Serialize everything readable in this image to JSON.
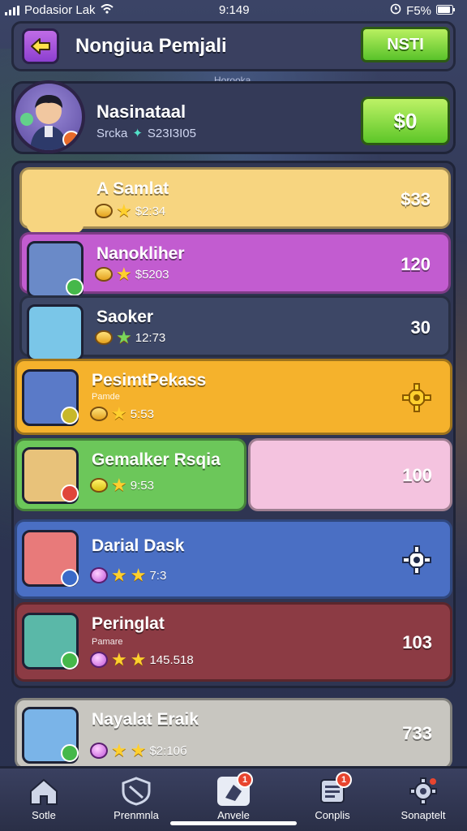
{
  "status_bar": {
    "carrier": "Podasior Lak",
    "time": "9:149",
    "battery": "F5%"
  },
  "header": {
    "title": "Nongiua Pemjali",
    "next_label": "NSTI",
    "subtitle": "Horooka"
  },
  "profile": {
    "name": "Nasinataal",
    "sub_label": "Srcka",
    "sub_value": "S23I3I05",
    "cash_label": "$0"
  },
  "rows": [
    {
      "name": "A Samlat",
      "tag": "",
      "stats": "$2:34",
      "value": "$33",
      "color": "#f7d580",
      "stars": 1,
      "currency": "coin"
    },
    {
      "name": "Nanokliher",
      "tag": "",
      "stats": "$5203",
      "value": "120",
      "color": "#c25cd0",
      "stars": 1,
      "currency": "coin"
    },
    {
      "name": "Saoker",
      "tag": "",
      "stats": "12:73",
      "value": "30",
      "color": "#3d4766",
      "stars": 1,
      "currency": "coin"
    },
    {
      "name": "PesimtPekass",
      "tag": "Pamde",
      "stats": "5:53",
      "value": "",
      "color": "#f5b22c",
      "stars": 1,
      "currency": "coin"
    },
    {
      "name": "Gemalker Rsqia",
      "tag": "",
      "stats": "9:53",
      "value": "100",
      "color": "#6cc75a",
      "stars": 1,
      "currency": "coin"
    },
    {
      "name": "Darial Dask",
      "tag": "",
      "stats": "7:3",
      "value": "",
      "color": "#4a6fc4",
      "stars": 2,
      "currency": "gem"
    },
    {
      "name": "Peringlat",
      "tag": "Pamare",
      "stats": "145.518",
      "value": "103",
      "color": "#8c3b44",
      "stars": 2,
      "currency": "gem"
    },
    {
      "name": "Nayalat Eraik",
      "tag": "",
      "stats": "$2:10б",
      "value": "733",
      "color": "#c8c6c0",
      "stars": 2,
      "currency": "gem"
    }
  ],
  "nav": [
    {
      "label": "Sotle",
      "icon": "home-icon",
      "badge": ""
    },
    {
      "label": "Prenmnla",
      "icon": "shield-icon",
      "badge": ""
    },
    {
      "label": "Anvele",
      "icon": "cards-icon",
      "badge": "1"
    },
    {
      "label": "Conplis",
      "icon": "list-icon",
      "badge": "1"
    },
    {
      "label": "Sonaptelt",
      "icon": "settings-gear-icon",
      "badge": ""
    }
  ],
  "colors": {
    "accent_green": "#5dc628",
    "accent_purple": "#8c3fd0",
    "frame": "#2f3552"
  }
}
